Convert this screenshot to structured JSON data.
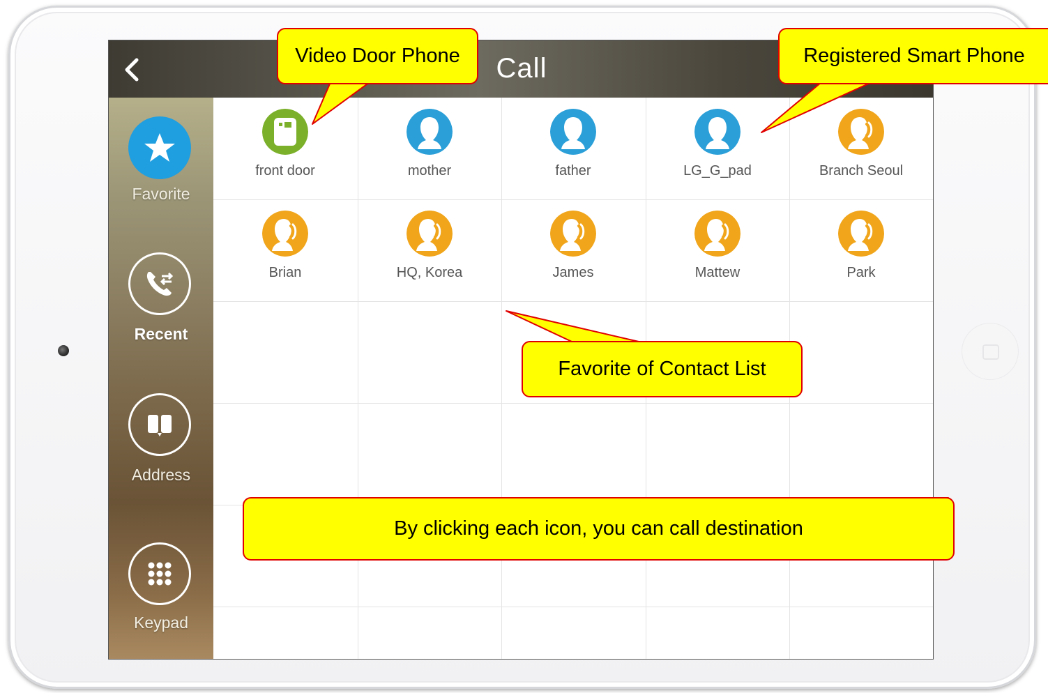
{
  "header": {
    "title": "Call"
  },
  "sidebar": {
    "items": [
      {
        "label": "Favorite",
        "icon": "star-icon",
        "active": true
      },
      {
        "label": "Recent",
        "icon": "phone-transfer-icon",
        "active": false
      },
      {
        "label": "Address",
        "icon": "book-icon",
        "active": false
      },
      {
        "label": "Keypad",
        "icon": "keypad-icon",
        "active": false
      }
    ]
  },
  "contacts": [
    {
      "name": "front door",
      "icon": "door-phone-icon",
      "color": "#7bb02a"
    },
    {
      "name": "mother",
      "icon": "person-icon",
      "color": "#2a9fd8"
    },
    {
      "name": "father",
      "icon": "person-icon",
      "color": "#2a9fd8"
    },
    {
      "name": "LG_G_pad",
      "icon": "person-icon",
      "color": "#2a9fd8"
    },
    {
      "name": "Branch Seoul",
      "icon": "person-phone-icon",
      "color": "#f0a51a"
    },
    {
      "name": "Brian",
      "icon": "person-phone-icon",
      "color": "#f0a51a"
    },
    {
      "name": "HQ, Korea",
      "icon": "person-phone-icon",
      "color": "#f0a51a"
    },
    {
      "name": "James",
      "icon": "person-phone-icon",
      "color": "#f0a51a"
    },
    {
      "name": "Mattew",
      "icon": "person-phone-icon",
      "color": "#f0a51a"
    },
    {
      "name": "Park",
      "icon": "person-phone-icon",
      "color": "#f0a51a"
    }
  ],
  "callouts": {
    "video_door_phone": "Video Door Phone",
    "registered_smart_phone": "Registered Smart Phone",
    "favorite_contact_list": "Favorite of Contact List",
    "click_hint": "By clicking each icon, you can call destination"
  },
  "colors": {
    "accent": "#1f9ee0",
    "callout_fill": "#ffff00",
    "callout_border": "#e00000"
  }
}
